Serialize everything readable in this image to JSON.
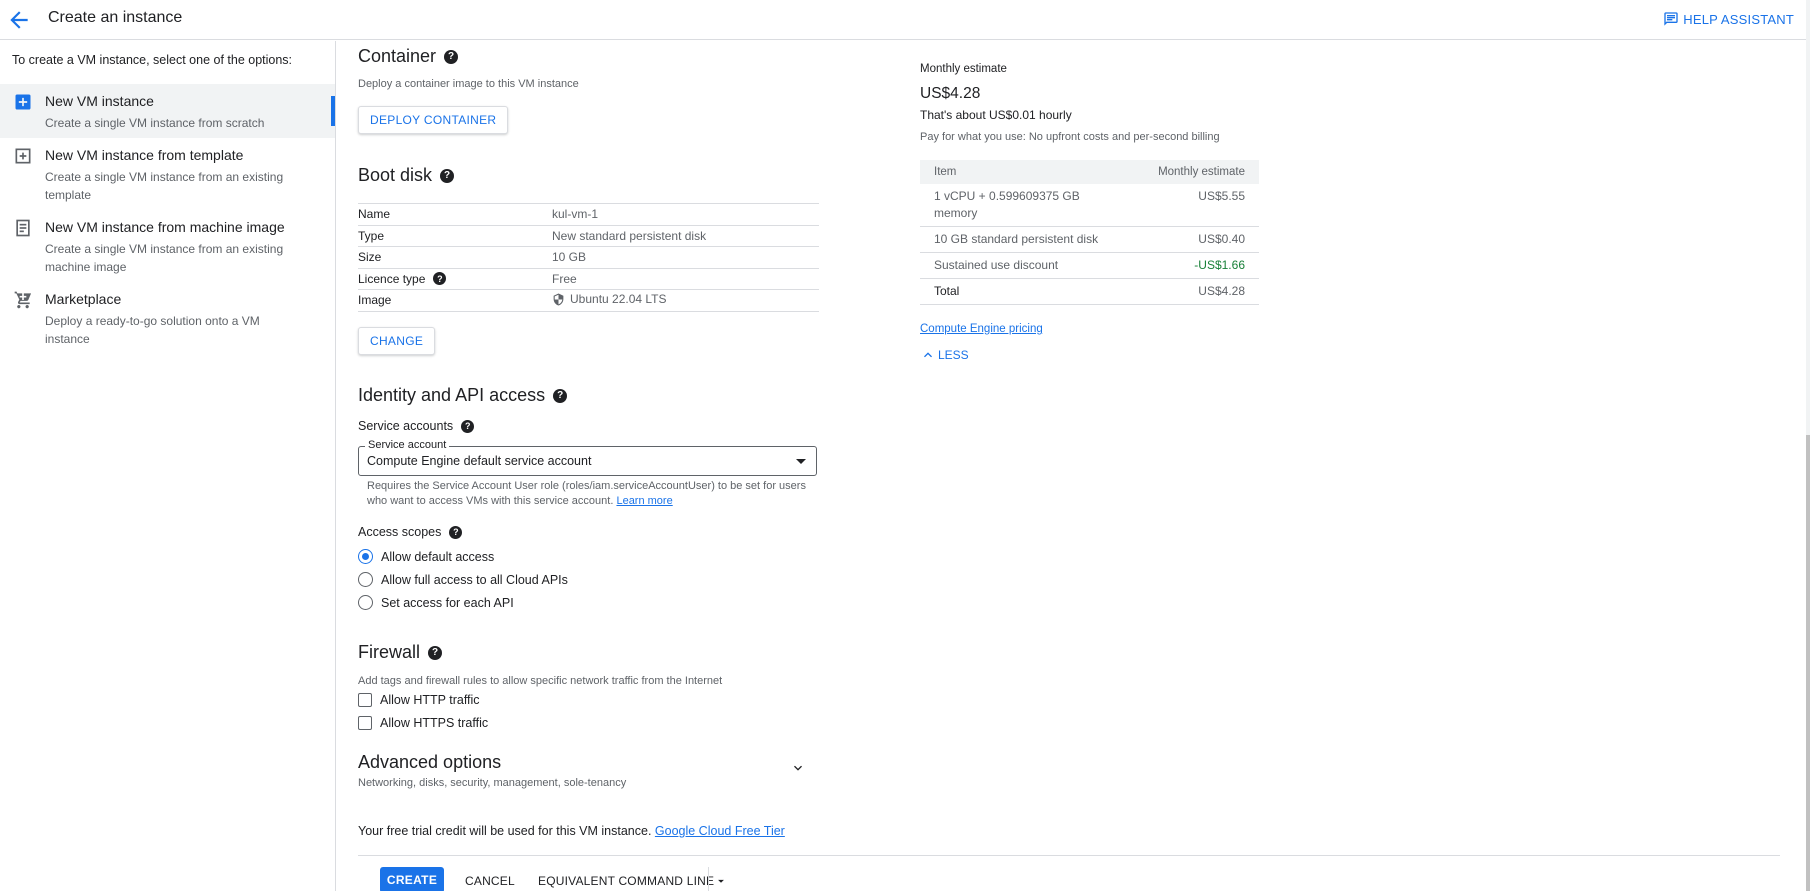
{
  "header": {
    "title": "Create an instance",
    "help_label": "HELP ASSISTANT"
  },
  "sidebar": {
    "intro": "To create a VM instance, select one of the options:",
    "options": [
      {
        "label": "New VM instance",
        "description": "Create a single VM instance from scratch",
        "icon": "add-box-icon",
        "active": true
      },
      {
        "label": "New VM instance from template",
        "description": "Create a single VM instance from an existing template",
        "icon": "template-add-icon"
      },
      {
        "label": "New VM instance from machine image",
        "description": "Create a single VM instance from an existing machine image",
        "icon": "machine-image-icon"
      },
      {
        "label": "Marketplace",
        "description": "Deploy a ready-to-go solution onto a VM instance",
        "icon": "cart-icon"
      }
    ]
  },
  "container": {
    "title": "Container",
    "description": "Deploy a container image to this VM instance",
    "button": "DEPLOY CONTAINER"
  },
  "boot_disk": {
    "title": "Boot disk",
    "rows": [
      {
        "key": "Name",
        "value": "kul-vm-1"
      },
      {
        "key": "Type",
        "value": "New standard persistent disk"
      },
      {
        "key": "Size",
        "value": "10 GB"
      },
      {
        "key": "Licence type",
        "value": "Free"
      },
      {
        "key": "Image",
        "value": "Ubuntu 22.04 LTS"
      }
    ],
    "change_button": "CHANGE"
  },
  "identity": {
    "title": "Identity and API access",
    "service_accounts_label": "Service accounts",
    "service_account_legend": "Service account",
    "service_account_value": "Compute Engine default service account",
    "note_line1": "Requires the Service Account User role (roles/iam.serviceAccountUser) to be set for users",
    "note_line2": "who want to access VMs with this service account.",
    "learn_more": "Learn more",
    "access_scopes_label": "Access scopes",
    "scopes": [
      {
        "label": "Allow default access",
        "selected": true
      },
      {
        "label": "Allow full access to all Cloud APIs",
        "selected": false
      },
      {
        "label": "Set access for each API",
        "selected": false
      }
    ]
  },
  "firewall": {
    "title": "Firewall",
    "description": "Add tags and firewall rules to allow specific network traffic from the Internet",
    "options": [
      {
        "label": "Allow HTTP traffic",
        "checked": false
      },
      {
        "label": "Allow HTTPS traffic",
        "checked": false
      }
    ]
  },
  "advanced": {
    "title": "Advanced options",
    "description": "Networking, disks, security, management, sole-tenancy"
  },
  "trial": {
    "text": "Your free trial credit will be used for this VM instance.",
    "link": "Google Cloud Free Tier"
  },
  "footer": {
    "create": "CREATE",
    "cancel": "CANCEL",
    "command_line": "EQUIVALENT COMMAND LINE"
  },
  "estimate": {
    "label": "Monthly estimate",
    "amount": "US$4.28",
    "hourly": "That's about US$0.01 hourly",
    "billing_note": "Pay for what you use: No upfront costs and per-second billing",
    "col_item": "Item",
    "col_estimate": "Monthly estimate",
    "rows": [
      {
        "item_line1": "1 vCPU + 0.599609375 GB",
        "item_line2": "memory",
        "value": "US$5.55"
      },
      {
        "item_line1": "10 GB standard persistent disk",
        "value": "US$0.40"
      },
      {
        "item_line1": "Sustained use discount",
        "value": "-US$1.66"
      },
      {
        "item_line1": "Total",
        "value": "US$4.28"
      }
    ],
    "pricing_link": "Compute Engine pricing",
    "less_label": "LESS"
  },
  "colors": {
    "accent": "#1a73e8",
    "discount": "#188038",
    "border": "#dadce0"
  }
}
